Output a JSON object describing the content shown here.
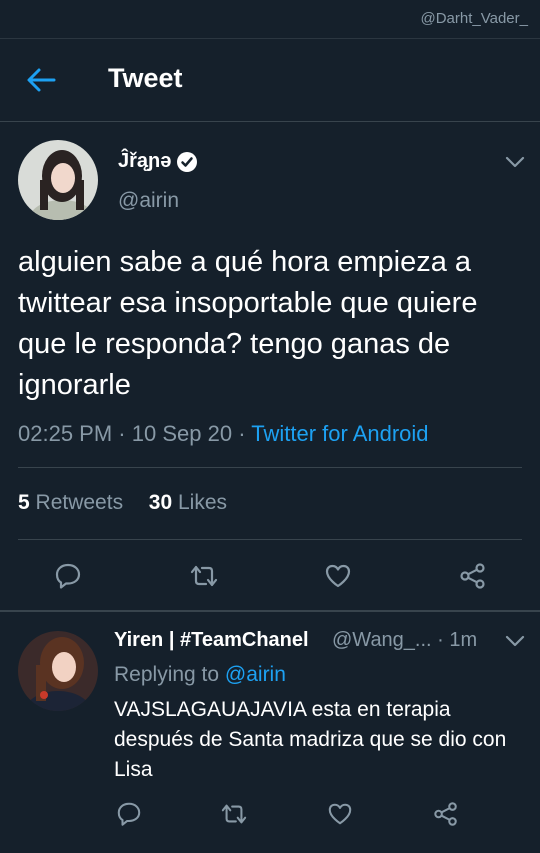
{
  "watermark": "@Darht_Vader_",
  "header": {
    "title": "Tweet"
  },
  "tweet": {
    "author_name": "Ĵřąɲə",
    "author_handle": "@airin",
    "text": "alguien sabe a qué hora empieza a twittear esa insoportable que quiere que le responda? tengo ganas de ignorarle",
    "time": "02:25 PM",
    "date": "10 Sep 20",
    "source": "Twitter for Android",
    "retweets_count": "5",
    "retweets_label": "Retweets",
    "likes_count": "30",
    "likes_label": "Likes"
  },
  "reply": {
    "author_name": "Yiren | #TeamChanel",
    "author_handle": "@Wang_...",
    "time": "1m",
    "replying_prefix": "Replying to",
    "replying_to": "@airin",
    "text": "VAJSLAGAUAJAVIA esta en terapia después de Santa madriza que se dio con Lisa"
  },
  "colors": {
    "background": "#15202b",
    "accent": "#1da1f2",
    "secondary_text": "#8899a6",
    "divider": "#38444d"
  },
  "icons": [
    "back-arrow-icon",
    "verified-badge-icon",
    "chevron-down-icon",
    "reply-icon",
    "retweet-icon",
    "like-icon",
    "share-icon"
  ]
}
